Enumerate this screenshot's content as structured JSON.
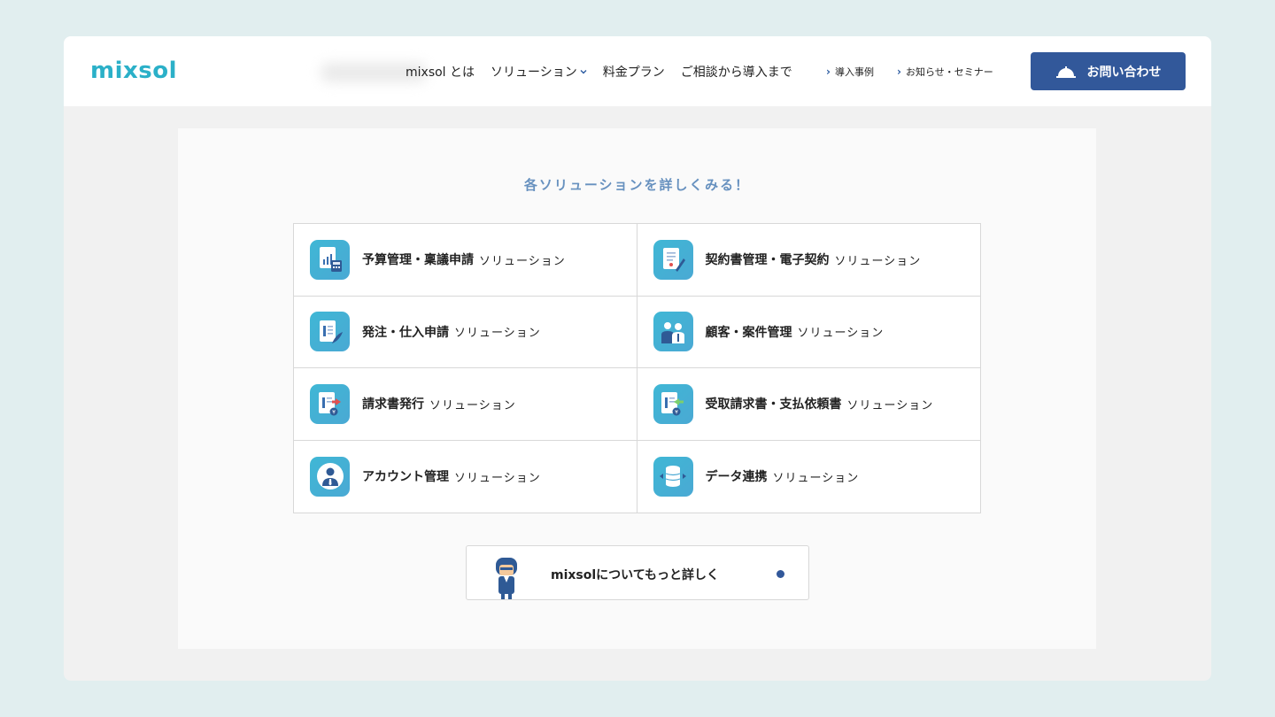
{
  "brand": {
    "logo": "mixsol",
    "accent": "#2bb0c8",
    "primary": "#32589a"
  },
  "nav": {
    "items": [
      {
        "label": "mixsol とは"
      },
      {
        "label": "ソリューション"
      },
      {
        "label": "料金プラン"
      },
      {
        "label": "ご相談から導入まで"
      }
    ],
    "sub_items": [
      {
        "label": "導入事例"
      },
      {
        "label": "お知らせ・セミナー"
      }
    ],
    "cta_label": "お問い合わせ"
  },
  "section": {
    "title": "各ソリューションを詳しくみる！",
    "suffix": "ソリューション",
    "solutions": [
      {
        "label": "予算管理・稟議申請",
        "icon": "budget-calculator-icon"
      },
      {
        "label": "契約書管理・電子契約",
        "icon": "contract-pen-icon"
      },
      {
        "label": "発注・仕入申請",
        "icon": "order-document-icon"
      },
      {
        "label": "顧客・案件管理",
        "icon": "customers-icon"
      },
      {
        "label": "請求書発行",
        "icon": "invoice-send-icon"
      },
      {
        "label": "受取請求書・支払依頼書",
        "icon": "invoice-receive-icon"
      },
      {
        "label": "アカウント管理",
        "icon": "account-user-icon"
      },
      {
        "label": "データ連携",
        "icon": "database-sync-icon"
      }
    ],
    "more_label": "mixsolについてもっと詳しく"
  }
}
